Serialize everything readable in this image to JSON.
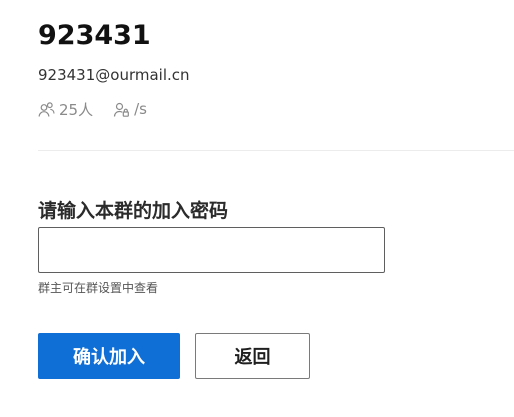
{
  "group": {
    "name": "923431",
    "email": "923431@ourmail.cn",
    "members": "25人",
    "rate": "/s"
  },
  "password": {
    "label": "请输入本群的加入密码",
    "value": "",
    "hint": "群主可在群设置中查看"
  },
  "actions": {
    "confirm_label": "确认加入",
    "back_label": "返回"
  },
  "colors": {
    "primary": "#0f6fd6",
    "muted_text": "#8a8a8a"
  },
  "icons": {
    "members": "people-icon",
    "rate": "user-lock-icon"
  }
}
